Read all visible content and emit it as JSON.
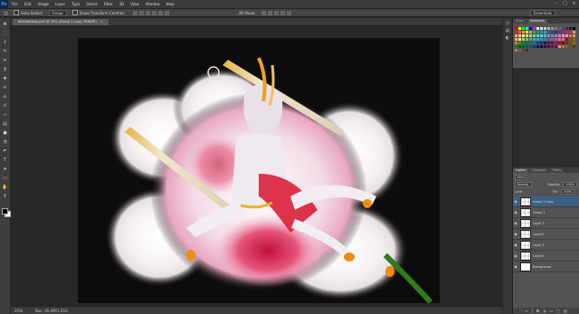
{
  "app": {
    "logo": "Ps"
  },
  "menubar": {
    "items": [
      "File",
      "Edit",
      "Image",
      "Layer",
      "Type",
      "Select",
      "Filter",
      "3D",
      "View",
      "Window",
      "Help"
    ],
    "window_controls": [
      "–",
      "□",
      "×"
    ]
  },
  "options": {
    "auto_select_label": "Auto-Select:",
    "auto_select_value": "Group",
    "show_transform_label": "Show Transform Controls",
    "mode_3d": "3D Mode:",
    "workspace": "Essentials"
  },
  "document": {
    "tab_title": "blahblahblar.psd @ 25% (Group 1 copy, RGB/8*)",
    "close": "×"
  },
  "status": {
    "zoom": "25%",
    "doc_info": "Doc: 40.4M/1.55G"
  },
  "swatches": {
    "tabs": [
      "Color",
      "Swatches"
    ],
    "colors": [
      "#ff0000",
      "#ffff00",
      "#00ff00",
      "#00ffff",
      "#0000ff",
      "#ff00ff",
      "#ffffff",
      "#e6e6e6",
      "#cccccc",
      "#b3b3b3",
      "#999999",
      "#808080",
      "#666666",
      "#4d4d4d",
      "#333333",
      "#1a1a1a",
      "#000000",
      "#ed1c24",
      "#f26522",
      "#f7941d",
      "#fff200",
      "#8dc63f",
      "#39b54a",
      "#00a651",
      "#00a99d",
      "#00aeef",
      "#0072bc",
      "#0054a6",
      "#2e3192",
      "#662d91",
      "#92278f",
      "#ec008c",
      "#ed145b",
      "#f69679",
      "#f9ad81",
      "#fdc68a",
      "#fff799",
      "#c4df9b",
      "#a3d39c",
      "#82ca9c",
      "#7accc8",
      "#6dcff6",
      "#7da7d9",
      "#8393ca",
      "#8781bd",
      "#a186be",
      "#bd8cbf",
      "#f49ac1",
      "#f5989d",
      "#f26c4f",
      "#f68e56",
      "#fbaf5d",
      "#fff568",
      "#acd373",
      "#7cc576",
      "#3cb878",
      "#1cbbb4",
      "#00bff3",
      "#448ccb",
      "#5674b9",
      "#605ca8",
      "#855fa8",
      "#a763a8",
      "#f06eaa",
      "#f26d7d",
      "#9e0b0f",
      "#a0410d",
      "#a3620a",
      "#aba000",
      "#598527",
      "#197b30",
      "#007236",
      "#00746b",
      "#0076a3",
      "#004a80",
      "#003471",
      "#1b1464",
      "#440e62",
      "#630460",
      "#9e005d",
      "#9e0039",
      "#790000",
      "#7b2e00",
      "#7d4900",
      "#827b00",
      "#406618",
      "#005e20",
      "#005826",
      "#005952",
      "#005b7f",
      "#003663",
      "#002157",
      "#0d004c",
      "#32004b",
      "#4b0049",
      "#7b0046",
      "#7a0026",
      "#c69c6d",
      "#a67c52",
      "#8c6239",
      "#754c24",
      "#603813",
      "#998675",
      "#736357",
      "#534741",
      "#362f2d"
    ]
  },
  "layers": {
    "tabs": [
      "Layers",
      "Channels",
      "Paths"
    ],
    "kind": "Kind",
    "blend_mode": "Normal",
    "opacity_label": "Opacity:",
    "opacity_value": "100%",
    "lock_label": "Lock:",
    "fill_label": "Fill:",
    "fill_value": "100%",
    "rows": [
      {
        "name": "Group 1 copy",
        "selected": true
      },
      {
        "name": "Group 1",
        "selected": false
      },
      {
        "name": "Layer 2",
        "selected": false
      },
      {
        "name": "Layer6",
        "selected": false
      },
      {
        "name": "Layer 1",
        "selected": false
      },
      {
        "name": "Layer8",
        "selected": false
      },
      {
        "name": "Background",
        "selected": false
      }
    ]
  }
}
